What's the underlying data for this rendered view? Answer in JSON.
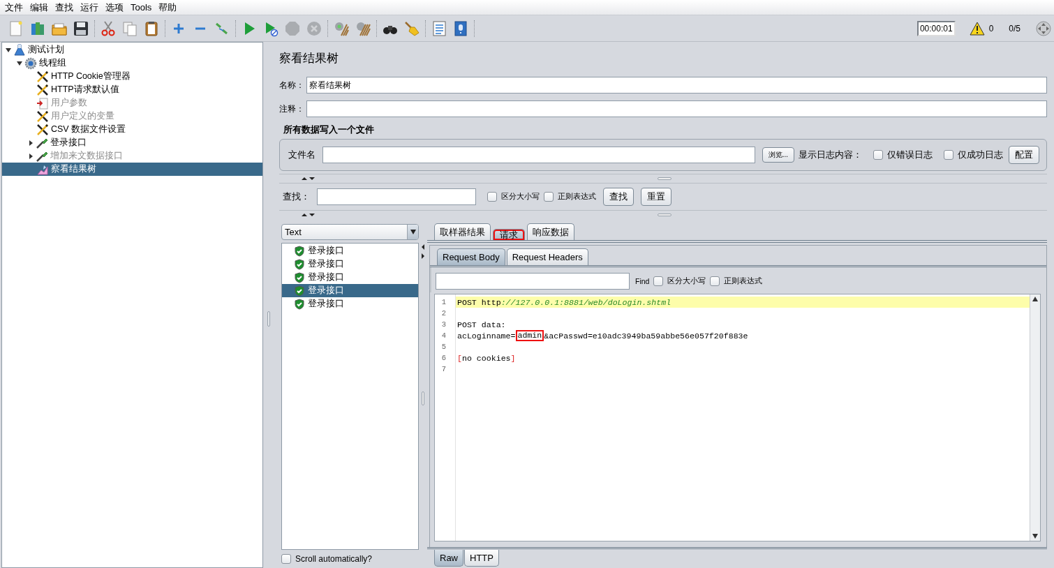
{
  "menu": [
    "文件",
    "编辑",
    "查找",
    "运行",
    "选项",
    "Tools",
    "帮助"
  ],
  "toolbar": {
    "groups": [
      [
        {
          "disabled": false
        },
        {
          "disabled": false
        },
        {
          "disabled": false
        },
        {
          "disabled": false
        }
      ],
      [
        {
          "disabled": false
        },
        {
          "disabled": false
        },
        {
          "disabled": false
        }
      ],
      [
        {
          "disabled": false
        },
        {
          "disabled": false
        },
        {
          "disabled": false
        }
      ],
      [
        {
          "disabled": false
        },
        {
          "disabled": false
        },
        {
          "disabled": true
        },
        {
          "disabled": true
        }
      ],
      [
        {
          "disabled": false
        },
        {
          "disabled": false
        }
      ],
      [
        {
          "disabled": false
        },
        {
          "disabled": false
        }
      ],
      [
        {
          "disabled": false
        },
        {
          "disabled": false
        }
      ]
    ]
  },
  "status": {
    "timer": "00:00:01",
    "warnings": "0",
    "threads": "0/5"
  },
  "tree": {
    "items": [
      {
        "label": "测试计划",
        "kind": "plan",
        "expanded": true,
        "disabled": false,
        "selected": false,
        "children": [
          {
            "label": "线程组",
            "kind": "threads",
            "expanded": true,
            "disabled": false,
            "selected": false,
            "children": [
              {
                "label": "HTTP Cookie管理器",
                "kind": "config",
                "disabled": false,
                "selected": false
              },
              {
                "label": "HTTP请求默认值",
                "kind": "config",
                "disabled": false,
                "selected": false
              },
              {
                "label": "用户参数",
                "kind": "preprocessor",
                "disabled": true,
                "selected": false
              },
              {
                "label": "用户定义的变量",
                "kind": "config",
                "disabled": true,
                "selected": false
              },
              {
                "label": "CSV 数据文件设置",
                "kind": "config",
                "disabled": false,
                "selected": false
              },
              {
                "label": "登录接口",
                "kind": "sampler",
                "expanded": false,
                "disabled": false,
                "selected": false
              },
              {
                "label": "增加来文数据接口",
                "kind": "sampler",
                "expanded": false,
                "disabled": true,
                "selected": false
              },
              {
                "label": "察看结果树",
                "kind": "listener",
                "disabled": false,
                "selected": true
              }
            ]
          }
        ]
      }
    ]
  },
  "panel": {
    "title": "察看结果树",
    "name": {
      "label": "名称：",
      "value": "察看结果树"
    },
    "comment": {
      "label": "注释："
    }
  },
  "file_section": {
    "heading": "所有数据写入一个文件",
    "filename_label": "文件名",
    "browse_button": "浏览...",
    "log_label": "显示日志内容：",
    "checkboxes": [
      {
        "label": "仅错误日志",
        "checked": false
      },
      {
        "label": "仅成功日志",
        "checked": false
      }
    ],
    "config_button": "配置"
  },
  "search": {
    "label": "查找：",
    "checkboxes": [
      {
        "label": "区分大小写",
        "checked": false
      },
      {
        "label": "正则表达式",
        "checked": false
      }
    ],
    "buttons": [
      "查找",
      "重置"
    ]
  },
  "results": {
    "renderer": "Text",
    "items": [
      {
        "label": "登录接口",
        "selected": false
      },
      {
        "label": "登录接口",
        "selected": false
      },
      {
        "label": "登录接口",
        "selected": false
      },
      {
        "label": "登录接口",
        "selected": true
      },
      {
        "label": "登录接口",
        "selected": false
      }
    ],
    "scroll_auto": {
      "label": "Scroll automatically?",
      "checked": false
    }
  },
  "tabs": [
    {
      "label": "取样器结果",
      "selected": false,
      "highlighted": false
    },
    {
      "label": "请求",
      "selected": true,
      "highlighted": true
    },
    {
      "label": "响应数据",
      "selected": false,
      "highlighted": false
    }
  ],
  "subtabs": [
    {
      "label": "Request Body",
      "selected": true
    },
    {
      "label": "Request Headers",
      "selected": false
    }
  ],
  "find": {
    "label": "Find",
    "checkboxes": [
      {
        "label": "区分大小写",
        "checked": false
      },
      {
        "label": "正则表达式",
        "checked": false
      }
    ]
  },
  "code": {
    "lines": [
      {
        "number": "1",
        "current": true,
        "segments": [
          {
            "kind": "plain",
            "text": "POST http",
            "highlighted": false
          },
          {
            "kind": "url",
            "text": "://127.0.0.1:8881/web/doLogin.shtml",
            "highlighted": false
          }
        ]
      },
      {
        "number": "2",
        "current": false
      },
      {
        "number": "3",
        "current": false,
        "segments": [
          {
            "kind": "plain",
            "text": "POST data:",
            "highlighted": false
          }
        ]
      },
      {
        "number": "4",
        "current": false,
        "segments": [
          {
            "kind": "plain",
            "text": "acLoginname=",
            "highlighted": false
          },
          {
            "kind": "plain",
            "text": "admin",
            "highlighted": true
          },
          {
            "kind": "plain",
            "text": "&acPasswd=e10adc3949ba59abbe56e057f20f883e",
            "highlighted": false
          }
        ]
      },
      {
        "number": "5",
        "current": false
      },
      {
        "number": "6",
        "current": false,
        "segments": [
          {
            "kind": "bracket",
            "text": "[",
            "highlighted": false
          },
          {
            "kind": "plain",
            "text": "no cookies",
            "highlighted": false
          },
          {
            "kind": "bracket",
            "text": "]",
            "highlighted": false
          }
        ]
      },
      {
        "number": "7",
        "current": false
      }
    ]
  },
  "bottom_tabs": [
    {
      "label": "Raw",
      "selected": true
    },
    {
      "label": "HTTP",
      "selected": false
    }
  ]
}
